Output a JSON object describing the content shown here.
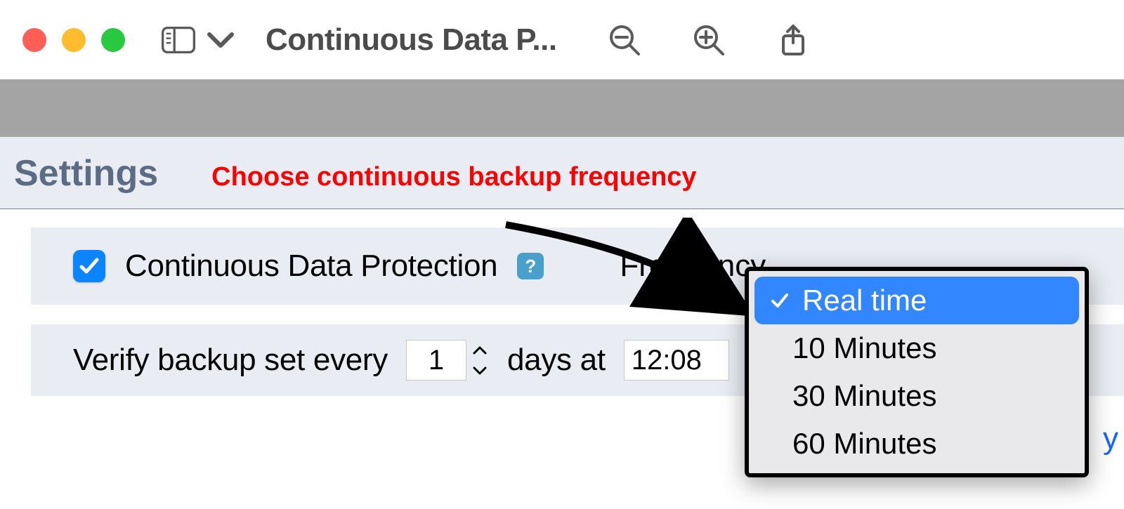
{
  "toolbar": {
    "title": "Continuous Data P..."
  },
  "settings_header": {
    "title": "Settings",
    "annotation": "Choose continuous backup frequency"
  },
  "cdp_row": {
    "checkbox_checked": true,
    "label": "Continuous Data Protection",
    "help_symbol": "?",
    "frequency_label": "Frequency"
  },
  "frequency_dropdown": {
    "selected": "Real time",
    "options": [
      "Real time",
      "10 Minutes",
      "30 Minutes",
      "60 Minutes"
    ]
  },
  "verify_row": {
    "label_prefix": "Verify backup set every",
    "days_value": "1",
    "label_middle": "days at",
    "time_value": "12:08"
  },
  "right_link_peek": "y N"
}
